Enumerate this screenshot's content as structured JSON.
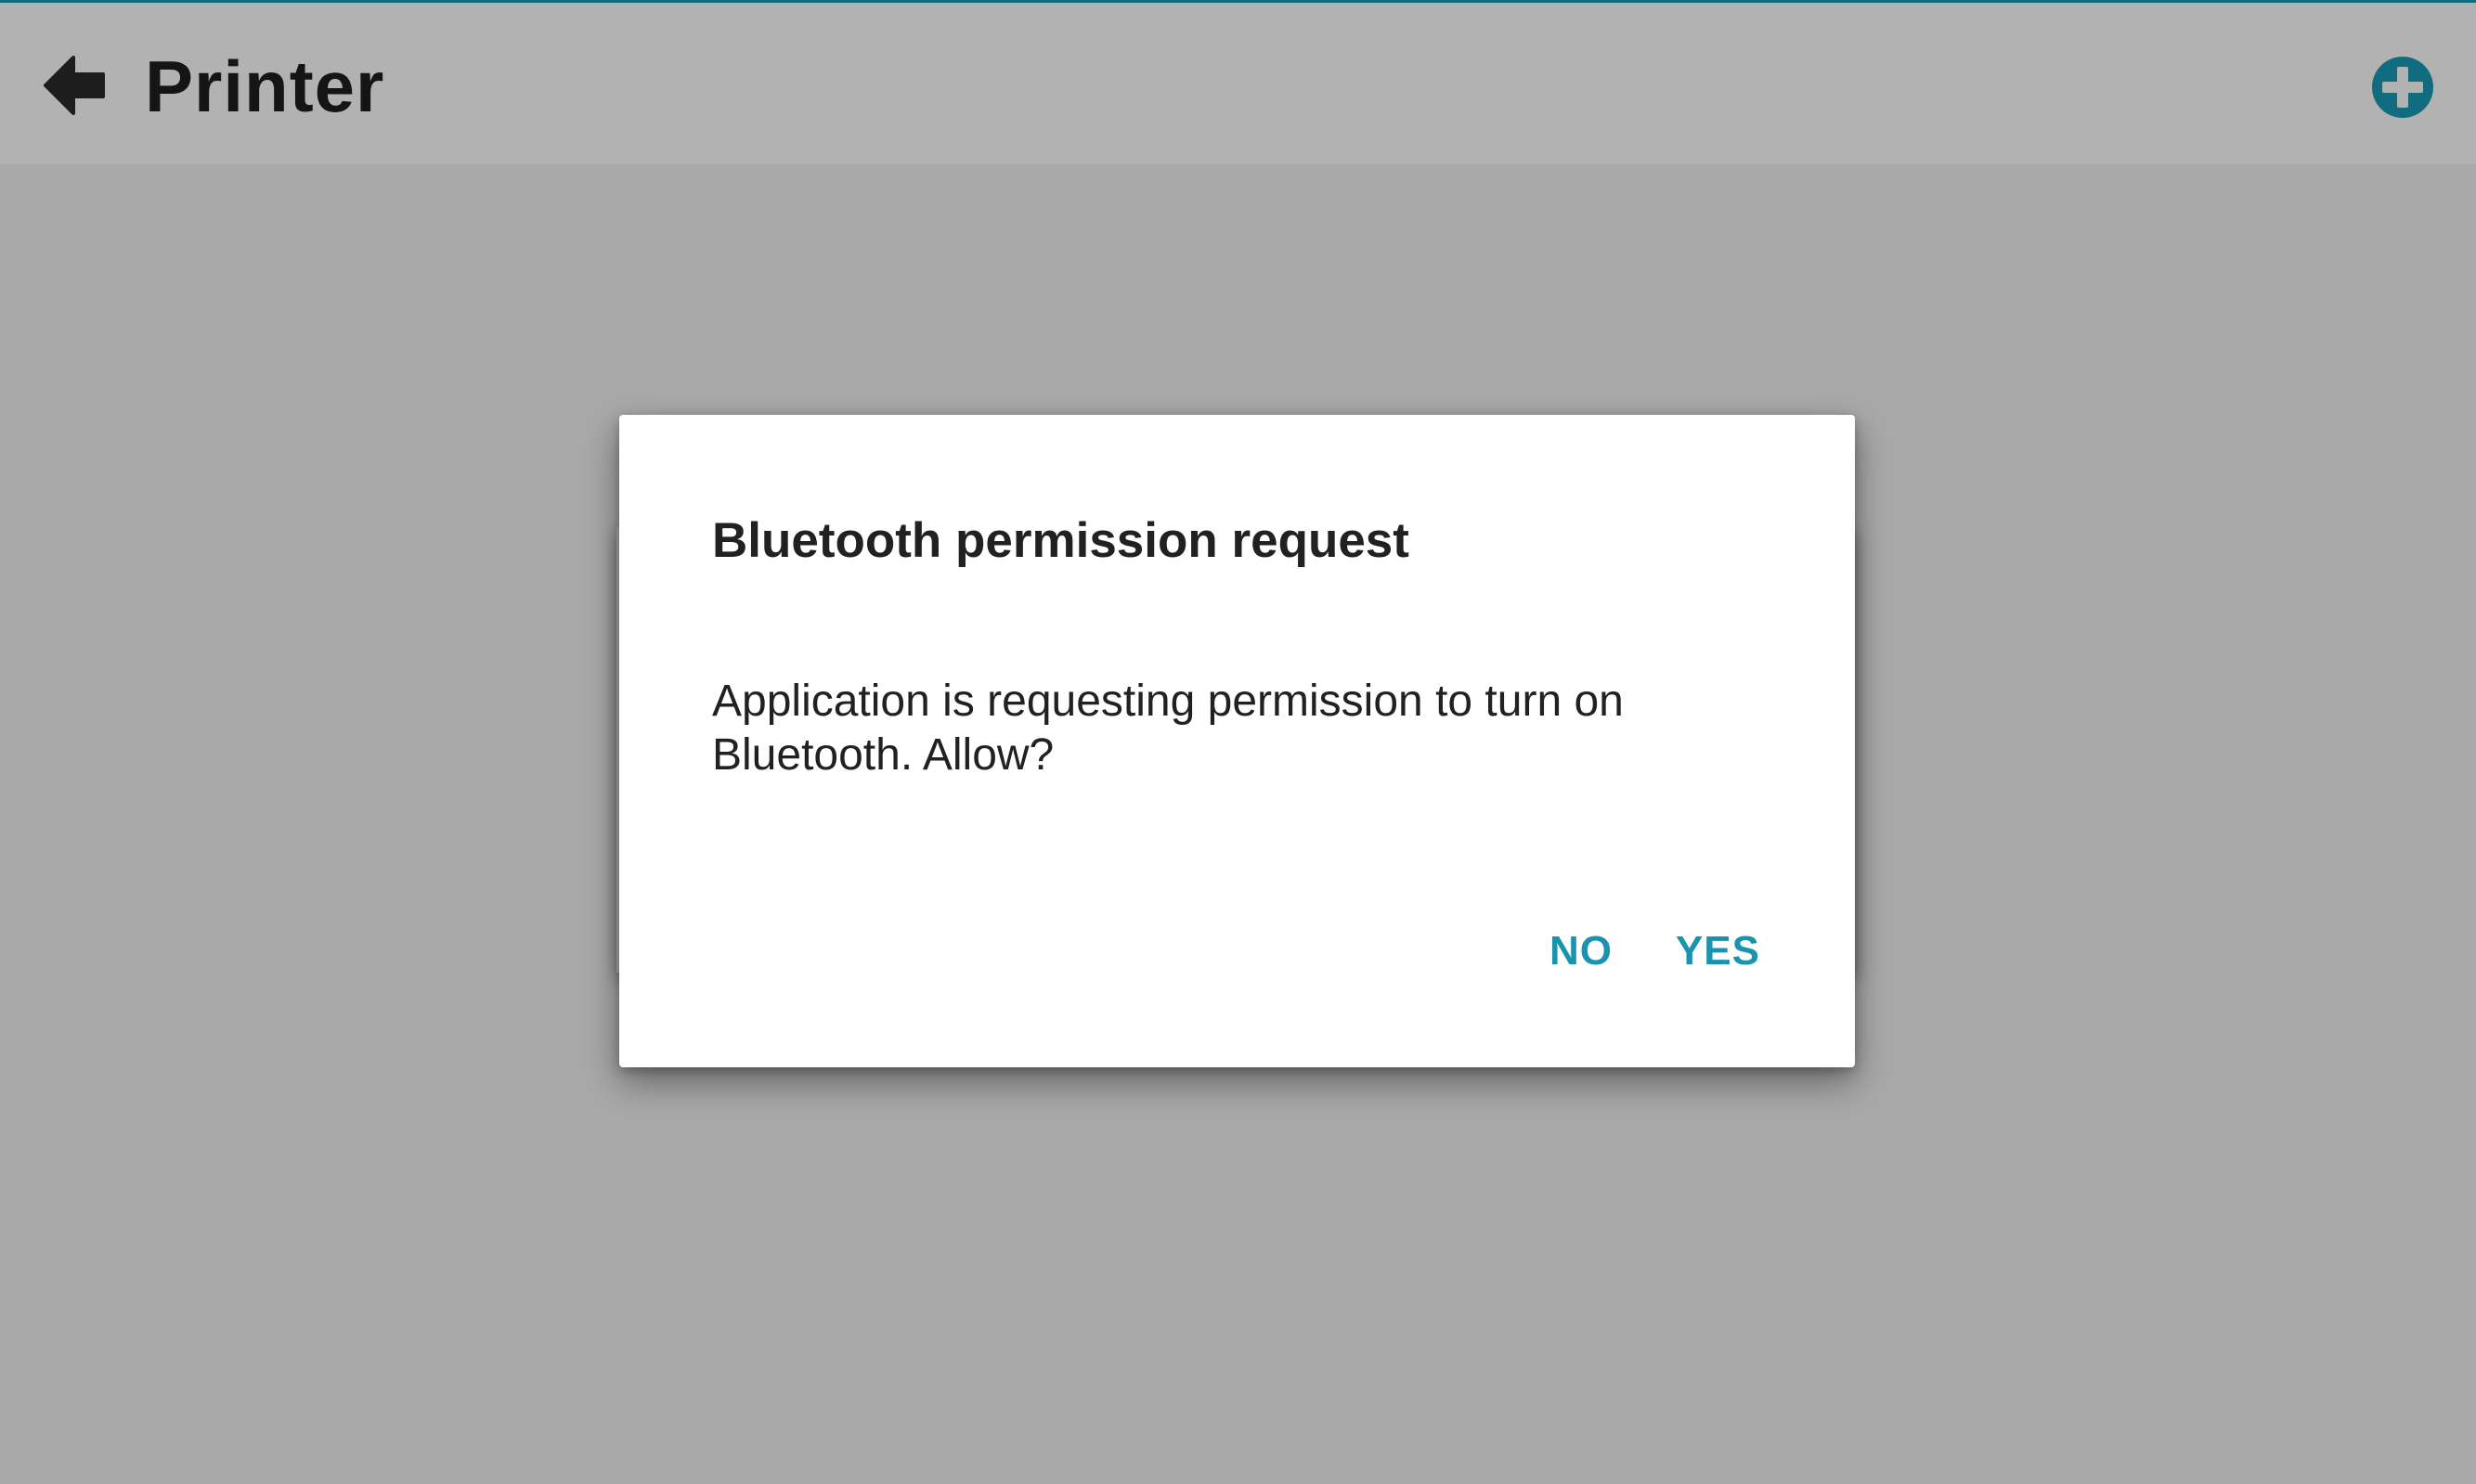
{
  "app": {
    "title": "Printer",
    "back_icon": "arrow-left-icon",
    "add_icon": "plus-circle-icon",
    "accent_color": "#1a9bb8"
  },
  "dialog": {
    "title": "Bluetooth permission request",
    "message": "Application is requesting permission to turn on Bluetooth. Allow?",
    "negative_label": "NO",
    "positive_label": "YES",
    "button_color": "#1a93b0"
  }
}
